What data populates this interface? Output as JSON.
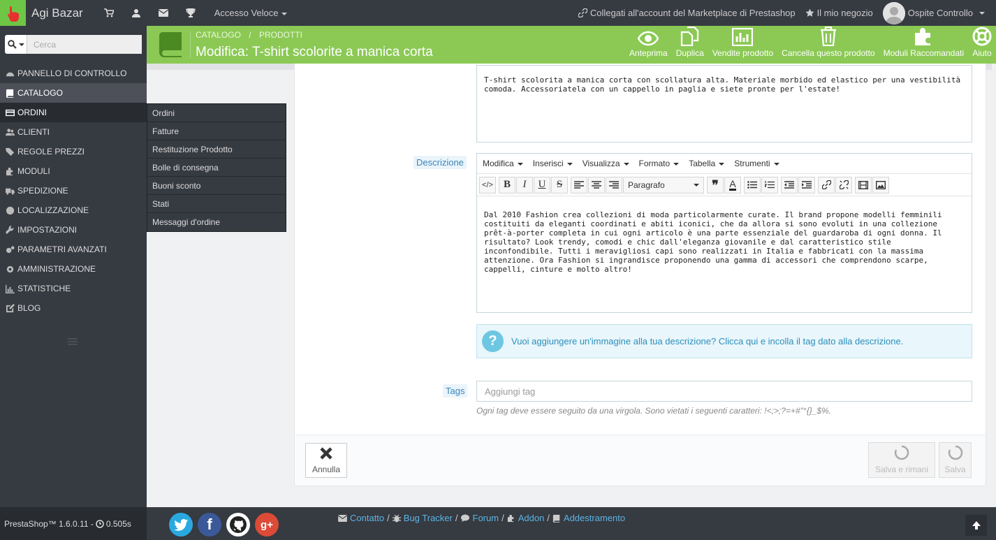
{
  "topbar": {
    "shop_name": "Agi Bazar",
    "quick_access": "Accesso Veloce",
    "marketplace": "Collegati all'account del Marketplace di Prestashop",
    "my_shop": "Il mio negozio",
    "user": "Ospite Controllo"
  },
  "sidebar": {
    "search_placeholder": "Cerca",
    "items": [
      "PANNELLO DI CONTROLLO",
      "CATALOGO",
      "ORDINI",
      "CLIENTI",
      "REGOLE PREZZI",
      "MODULI",
      "SPEDIZIONE",
      "LOCALIZZAZIONE",
      "IMPOSTAZIONI",
      "PARAMETRI AVANZATI",
      "AMMINISTRAZIONE",
      "STATISTICHE",
      "BLOG"
    ],
    "version": "PrestaShop™ 1.6.0.11 - ",
    "load_time": "0.505s"
  },
  "submenu": [
    "Ordini",
    "Fatture",
    "Restituzione Prodotto",
    "Bolle di consegna",
    "Buoni sconto",
    "Stati",
    "Messaggi d'ordine"
  ],
  "header": {
    "breadcrumb_1": "CATALOGO",
    "breadcrumb_sep": "/",
    "breadcrumb_2": "PRODOTTI",
    "title": "Modifica: T-shirt scolorite a manica corta",
    "tools": [
      "Anteprima",
      "Duplica",
      "Vendite prodotto",
      "Cancella questo prodotto",
      "Moduli Raccomandati",
      "Aiuto"
    ]
  },
  "form": {
    "summary": "T-shirt scolorita a manica corta con scollatura alta. Materiale morbido ed elastico per una vestibilità comoda. Accessoriatela con un cappello in paglia e siete pronte per l'estate!",
    "description_label": "Descrizione",
    "editor_menu": [
      "Modifica",
      "Inserisci",
      "Visualizza",
      "Formato",
      "Tabella",
      "Strumenti"
    ],
    "paragraph": "Paragrafo",
    "description_text": "Dal 2010 Fashion crea collezioni di moda particolarmente curate. Il brand propone modelli femminili costituiti da eleganti coordinati e abiti iconici, che da allora si sono evoluti in una collezione prêt-à-porter completa in cui ogni articolo è una parte essenziale del guardaroba di ogni donna. Il risultato? Look trendy, comodi e chic dall'eleganza giovanile e dal caratteristico stile inconfondibile. Tutti i meravigliosi capi sono realizzati in Italia e fabbricati con la massima attenzione. Ora Fashion si ingrandisce proponendo una gamma di accessori che comprendono scarpe, cappelli, cinture e molto altro!",
    "image_tip": "Vuoi aggiungere un'immagine alla tua descrizione? Clicca qui e incolla il tag dato alla descrizione.",
    "tags_label": "Tags",
    "tags_placeholder": "Aggiungi tag",
    "tags_help": "Ogni tag deve essere seguito da una virgola. Sono vietati i seguenti caratteri: !<;>;?=+#\"°{}_$%.",
    "cancel": "Annulla",
    "save_stay": "Salva e rimani",
    "save": "Salva"
  },
  "footer": {
    "links": [
      "Contatto",
      "Bug Tracker",
      "Forum",
      "Addon",
      "Addestramento"
    ],
    "sep": "/"
  },
  "colors": {
    "accent": "#8bc954",
    "dark": "#363a41",
    "link": "#2b8fbd"
  }
}
